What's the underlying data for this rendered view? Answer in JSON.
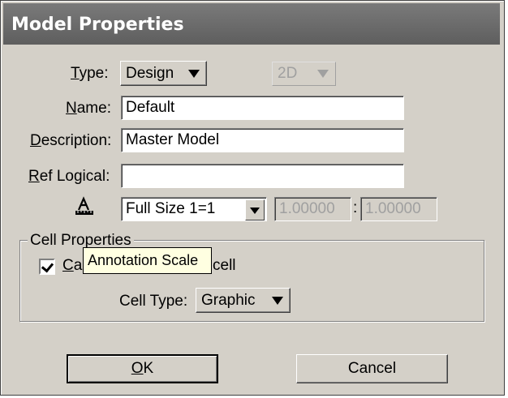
{
  "window": {
    "title": "Model Properties"
  },
  "type": {
    "label": "Type:",
    "value": "Design",
    "dimension": "2D"
  },
  "name": {
    "label": "Name:",
    "value": "Default"
  },
  "description": {
    "label": "Description:",
    "value": "Master Model"
  },
  "ref_logical": {
    "label": "Ref Logical:",
    "value": ""
  },
  "annotation": {
    "icon": "annotation-scale-icon",
    "scale": "Full Size 1=1",
    "ratio_left": "1.00000",
    "separator": ":",
    "ratio_right": "1.00000",
    "tooltip": "Annotation Scale"
  },
  "cell_properties": {
    "group_label": "Cell Properties",
    "checkbox_label_visible_start": "Ca",
    "checkbox_label_visible_end": "cell",
    "checked": true,
    "cell_type_label": "Cell Type:",
    "cell_type_value": "Graphic"
  },
  "buttons": {
    "ok": "OK",
    "cancel": "Cancel"
  }
}
